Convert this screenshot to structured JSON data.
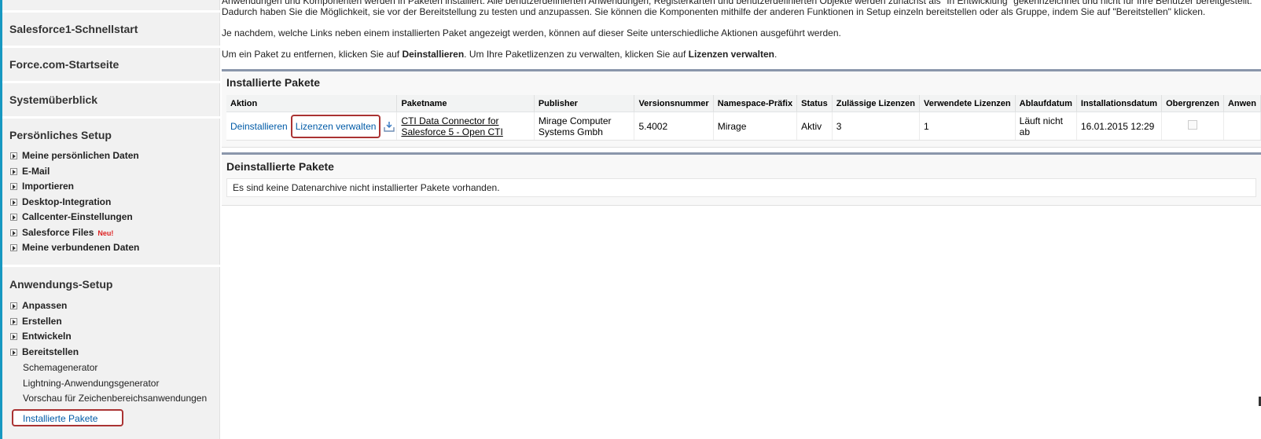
{
  "sidebar": {
    "sections": [
      {
        "label": "Salesforce1-Schnellstart"
      },
      {
        "label": "Force.com-Startseite"
      },
      {
        "label": "Systemüberblick"
      }
    ],
    "personal_setup": {
      "title": "Persönliches Setup",
      "items": [
        {
          "label": "Meine persönlichen Daten"
        },
        {
          "label": "E-Mail"
        },
        {
          "label": "Importieren"
        },
        {
          "label": "Desktop-Integration"
        },
        {
          "label": "Callcenter-Einstellungen"
        },
        {
          "label": "Salesforce Files",
          "badge": "Neu!"
        },
        {
          "label": "Meine verbundenen Daten"
        }
      ]
    },
    "app_setup": {
      "title": "Anwendungs-Setup",
      "items": [
        {
          "label": "Anpassen"
        },
        {
          "label": "Erstellen"
        },
        {
          "label": "Entwickeln"
        },
        {
          "label": "Bereitstellen"
        }
      ],
      "subitems": [
        {
          "label": "Schemagenerator"
        },
        {
          "label": "Lightning-Anwendungsgenerator"
        },
        {
          "label": "Vorschau für Zeichenbereichsanwendungen"
        }
      ],
      "selected": "Installierte Pakete"
    }
  },
  "intro": {
    "line1": "Anwendungen und Komponenten werden in Paketen installiert. Alle benutzerdefinierten Anwendungen, Registerkarten und benutzerdefinierten Objekte werden zunächst als \"In Entwicklung\" gekennzeichnet und nicht für Ihre Benutzer bereitgestellt.",
    "line2": "Dadurch haben Sie die Möglichkeit, sie vor der Bereitstellung zu testen und anzupassen. Sie können die Komponenten mithilfe der anderen Funktionen in Setup einzeln bereitstellen oder als Gruppe, indem Sie auf \"Bereitstellen\" klicken.",
    "line3": "Je nachdem, welche Links neben einem installierten Paket angezeigt werden, können auf dieser Seite unterschiedliche Aktionen ausgeführt werden.",
    "line4_pre": "Um ein Paket zu entfernen, klicken Sie auf ",
    "line4_b1": "Deinstallieren",
    "line4_mid": ". Um Ihre Paketlizenzen zu verwalten, klicken Sie auf ",
    "line4_b2": "Lizenzen verwalten",
    "line4_end": "."
  },
  "installed": {
    "title": "Installierte Pakete",
    "columns": [
      "Aktion",
      "Paketname",
      "Publisher",
      "Versionsnummer",
      "Namespace-Präfix",
      "Status",
      "Zulässige Lizenzen",
      "Verwendete Lizenzen",
      "Ablaufdatum",
      "Installationsdatum",
      "Obergrenzen",
      "Anwen"
    ],
    "row": {
      "uninstall": "Deinstallieren",
      "manage": "Lizenzen verwalten",
      "package_line1": "CTI Data Connector for",
      "package_line2": "Salesforce 5 - Open CTI",
      "publisher_line1": "Mirage Computer",
      "publisher_line2": "Systems Gmbh",
      "version": "5.4002",
      "namespace": "Mirage",
      "status": "Aktiv",
      "allowed": "3",
      "used": "1",
      "expiry_line1": "Läuft nicht",
      "expiry_line2": "ab",
      "installed_on": "16.01.2015 12:29"
    }
  },
  "uninstalled": {
    "title": "Deinstallierte Pakete",
    "empty": "Es sind keine Datenarchive nicht installierter Pakete vorhanden."
  },
  "icons": {
    "expand": "expand-triangle-icon",
    "download": "download-icon",
    "checkbox": "checkbox-icon"
  }
}
